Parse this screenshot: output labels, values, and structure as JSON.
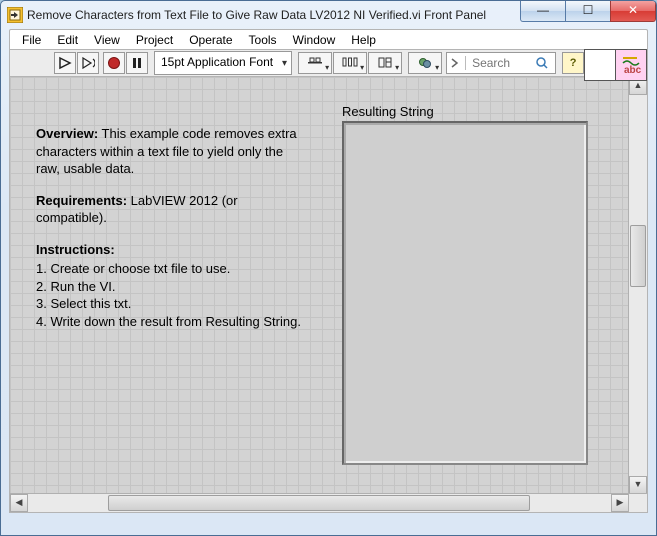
{
  "window": {
    "title": "Remove Characters from Text File to Give Raw Data LV2012 NI Verified.vi Front Panel"
  },
  "menu": {
    "items": [
      "File",
      "Edit",
      "View",
      "Project",
      "Operate",
      "Tools",
      "Window",
      "Help"
    ]
  },
  "toolbar": {
    "font": "15pt Application Font",
    "search_placeholder": "Search"
  },
  "panel": {
    "overview_label": "Overview:",
    "overview_text": "This example code removes extra characters within a text file to yield only the raw, usable data.",
    "requirements_label": "Requirements:",
    "requirements_text": "LabVIEW 2012 (or compatible).",
    "instructions_label": "Instructions:",
    "instructions": [
      "1. Create or choose txt file to use.",
      "2. Run the VI.",
      "3. Select this txt.",
      "4. Write down the result from Resulting String."
    ],
    "result_label": "Resulting String",
    "result_value": ""
  },
  "captions": {
    "min": "—",
    "max": "☐",
    "close": "✕"
  },
  "colors": {
    "help": "#fff6c8"
  }
}
